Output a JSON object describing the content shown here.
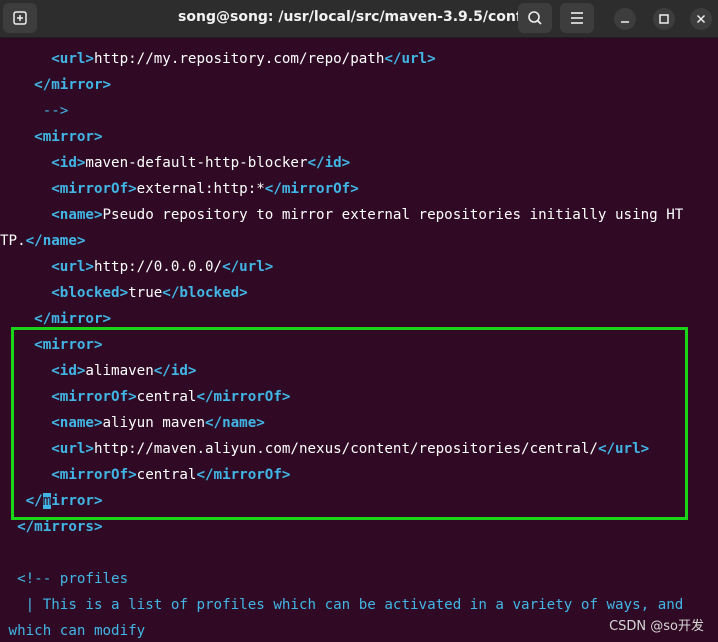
{
  "window": {
    "title": "song@song: /usr/local/src/maven-3.9.5/conf",
    "new_tab_icon": "new-tab-icon",
    "search_icon": "search-icon",
    "menu_icon": "hamburger-menu-icon",
    "minimize_icon": "minimize-icon",
    "maximize_icon": "maximize-icon",
    "close_icon": "close-icon"
  },
  "terminal": {
    "lines": [
      [
        {
          "t": "      "
        },
        {
          "t": "<url>",
          "c": "tag"
        },
        {
          "t": "http://my.repository.com/repo/path"
        },
        {
          "t": "</url>",
          "c": "tag"
        }
      ],
      [
        {
          "t": "    "
        },
        {
          "t": "</mirror>",
          "c": "tag"
        }
      ],
      [
        {
          "t": "     "
        },
        {
          "t": "-->",
          "c": "cmt"
        }
      ],
      [
        {
          "t": "    "
        },
        {
          "t": "<mirror>",
          "c": "tag"
        }
      ],
      [
        {
          "t": "      "
        },
        {
          "t": "<id>",
          "c": "tag"
        },
        {
          "t": "maven-default-http-blocker"
        },
        {
          "t": "</id>",
          "c": "tag"
        }
      ],
      [
        {
          "t": "      "
        },
        {
          "t": "<mirrorOf>",
          "c": "tag"
        },
        {
          "t": "external:http:*"
        },
        {
          "t": "</mirrorOf>",
          "c": "tag"
        }
      ],
      [
        {
          "t": "      "
        },
        {
          "t": "<name>",
          "c": "tag"
        },
        {
          "t": "Pseudo repository to mirror external repositories initially using HT"
        }
      ],
      [
        {
          "t": "TP."
        },
        {
          "t": "</name>",
          "c": "tag"
        }
      ],
      [
        {
          "t": "      "
        },
        {
          "t": "<url>",
          "c": "tag"
        },
        {
          "t": "http://0.0.0.0/"
        },
        {
          "t": "</url>",
          "c": "tag"
        }
      ],
      [
        {
          "t": "      "
        },
        {
          "t": "<blocked>",
          "c": "tag"
        },
        {
          "t": "true"
        },
        {
          "t": "</blocked>",
          "c": "tag"
        }
      ],
      [
        {
          "t": "    "
        },
        {
          "t": "</mirror>",
          "c": "tag"
        }
      ],
      [
        {
          "t": "    "
        },
        {
          "t": "<mirror>",
          "c": "tag"
        }
      ],
      [
        {
          "t": "      "
        },
        {
          "t": "<id>",
          "c": "tag"
        },
        {
          "t": "alimaven"
        },
        {
          "t": "</id>",
          "c": "tag"
        }
      ],
      [
        {
          "t": "      "
        },
        {
          "t": "<mirrorOf>",
          "c": "tag"
        },
        {
          "t": "central"
        },
        {
          "t": "</mirrorOf>",
          "c": "tag"
        }
      ],
      [
        {
          "t": "      "
        },
        {
          "t": "<name>",
          "c": "tag"
        },
        {
          "t": "aliyun maven"
        },
        {
          "t": "</name>",
          "c": "tag"
        }
      ],
      [
        {
          "t": "      "
        },
        {
          "t": "<url>",
          "c": "tag"
        },
        {
          "t": "http://maven.aliyun.com/nexus/content/repositories/central/"
        },
        {
          "t": "</url>",
          "c": "tag"
        }
      ],
      [
        {
          "t": "      "
        },
        {
          "t": "<mirrorOf>",
          "c": "tag"
        },
        {
          "t": "central"
        },
        {
          "t": "</mirrorOf>",
          "c": "tag"
        }
      ],
      [
        {
          "t": "   "
        },
        {
          "t": "</",
          "c": "tag"
        },
        {
          "t": "m",
          "c": "cursor"
        },
        {
          "t": "irror>",
          "c": "tag"
        }
      ],
      [
        {
          "t": "  "
        },
        {
          "t": "</mirrors>",
          "c": "tag"
        }
      ],
      [
        {
          "t": ""
        }
      ],
      [
        {
          "t": "  "
        },
        {
          "t": "<!-- profiles",
          "c": "cmt"
        }
      ],
      [
        {
          "t": "   | This is a list of profiles which can be activated in a variety of ways, and",
          "c": "cmt"
        }
      ],
      [
        {
          "t": " which can modify",
          "c": "cmt"
        }
      ]
    ]
  },
  "watermark": "CSDN @so开发",
  "colors": {
    "background": "#300a24",
    "tag": "#41b6e6",
    "text": "#ffffff",
    "highlight_box": "#19d419",
    "titlebar": "#2d2d2d"
  }
}
